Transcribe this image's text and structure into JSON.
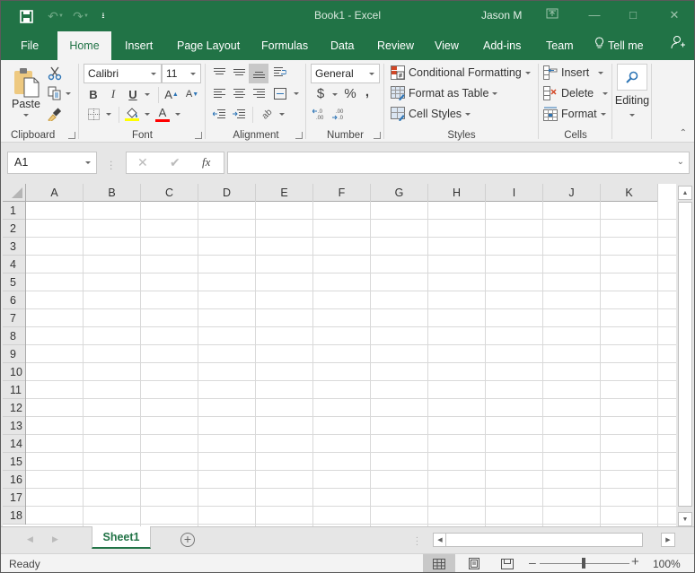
{
  "titlebar": {
    "title": "Book1  -  Excel",
    "user": "Jason M",
    "quick_access": [
      {
        "icon": "save-icon"
      },
      {
        "icon": "undo-icon"
      },
      {
        "icon": "redo-icon"
      },
      {
        "icon": "customize-quick-access-icon"
      }
    ],
    "window_controls": [
      "ribbon-display-options-icon",
      "minimize-icon",
      "maximize-icon",
      "close-icon"
    ]
  },
  "tabs": [
    {
      "label": "File"
    },
    {
      "label": "Home",
      "active": true
    },
    {
      "label": "Insert"
    },
    {
      "label": "Page Layout"
    },
    {
      "label": "Formulas"
    },
    {
      "label": "Data"
    },
    {
      "label": "Review"
    },
    {
      "label": "View"
    },
    {
      "label": "Add-ins"
    },
    {
      "label": "Team"
    },
    {
      "label": "Tell me"
    }
  ],
  "ribbon": {
    "clipboard": {
      "label": "Clipboard",
      "paste": "Paste"
    },
    "font": {
      "label": "Font",
      "font_name": "Calibri",
      "font_size": "11",
      "bold": "B",
      "italic": "I",
      "underline": "U",
      "highlight_color": "#ffff00",
      "font_color": "#ff0000"
    },
    "alignment": {
      "label": "Alignment"
    },
    "number": {
      "label": "Number",
      "format": "General",
      "currency": "$",
      "percent": "%",
      "comma": ","
    },
    "styles": {
      "label": "Styles",
      "conditional_formatting": "Conditional Formatting",
      "format_as_table": "Format as Table",
      "cell_styles": "Cell Styles"
    },
    "cells": {
      "label": "Cells",
      "insert": "Insert",
      "delete": "Delete",
      "format": "Format"
    },
    "editing": {
      "label": "Editing"
    }
  },
  "formula_bar": {
    "name_box": "A1",
    "fx": "fx",
    "value": ""
  },
  "grid": {
    "columns": [
      "A",
      "B",
      "C",
      "D",
      "E",
      "F",
      "G",
      "H",
      "I",
      "J",
      "K"
    ],
    "rows": [
      "1",
      "2",
      "3",
      "4",
      "5",
      "6",
      "7",
      "8",
      "9",
      "10",
      "11",
      "12",
      "13",
      "14",
      "15",
      "16",
      "17",
      "18"
    ]
  },
  "sheets": [
    {
      "label": "Sheet1",
      "active": true
    }
  ],
  "status": {
    "text": "Ready",
    "zoom": "100%",
    "zoom_percent": 100
  },
  "colors": {
    "brand": "#217346",
    "ribbon_bg": "#f3f3f3"
  }
}
